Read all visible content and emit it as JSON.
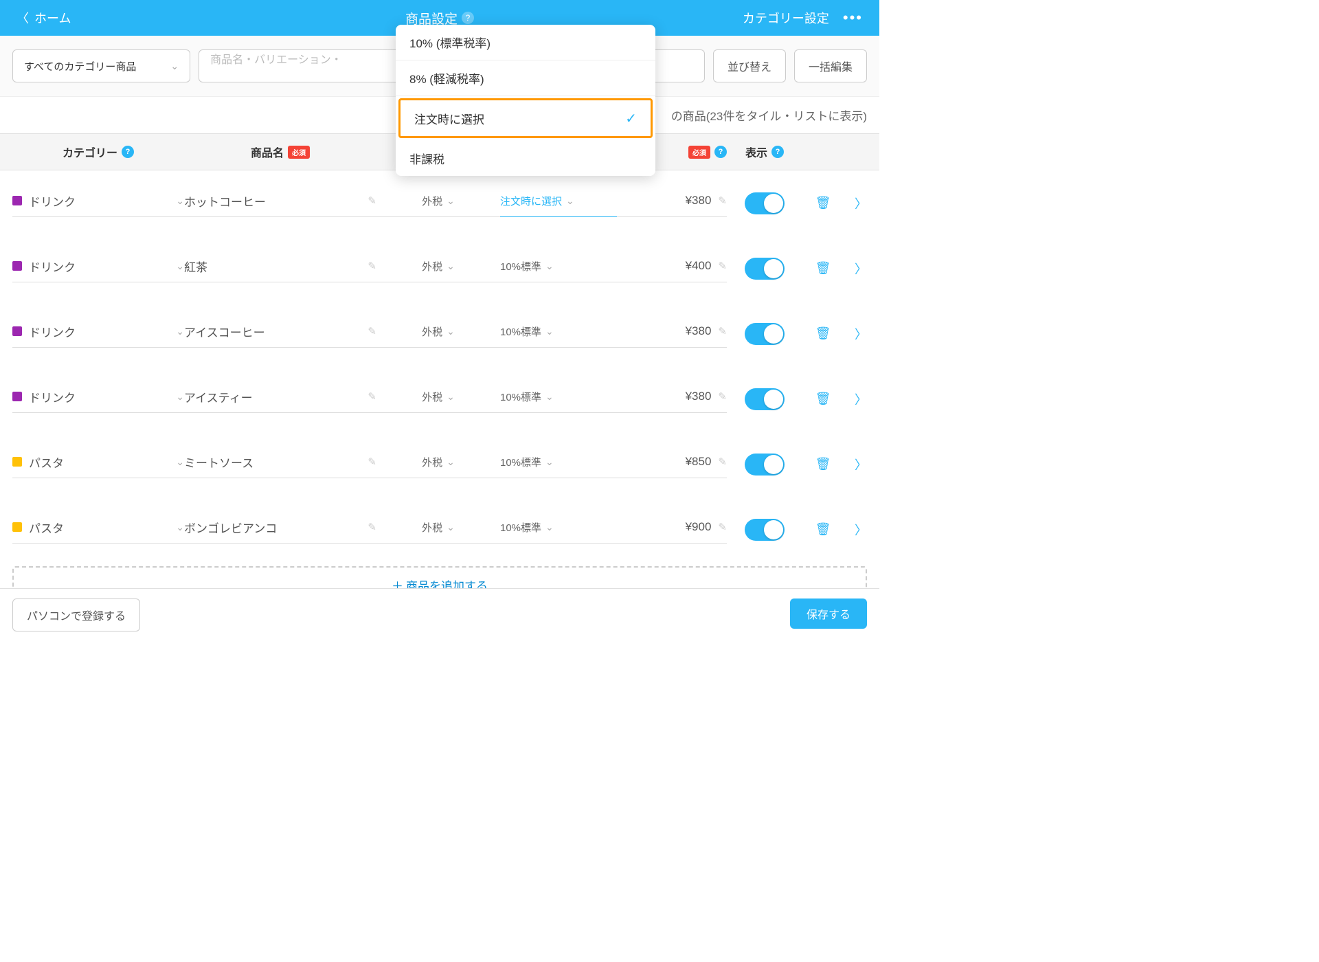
{
  "header": {
    "back": "ホーム",
    "title": "商品設定",
    "right_link": "カテゴリー設定"
  },
  "toolbar": {
    "category_filter": "すべてのカテゴリー商品",
    "search_placeholder": "商品名・バリエーション・",
    "sort_btn": "並び替え",
    "bulk_btn": "一括編集"
  },
  "summary": "の商品(23件をタイル・リストに表示)",
  "headers": {
    "category": "カテゴリー",
    "name": "商品名",
    "required": "必須",
    "display": "表示"
  },
  "dropdown": {
    "opt1": "10% (標準税率)",
    "opt2": "8% (軽減税率)",
    "opt3": "注文時に選択",
    "opt4": "非課税"
  },
  "rows": [
    {
      "cat": "ドリンク",
      "color": "purple",
      "name": "ホットコーヒー",
      "tax": "外税",
      "rate": "注文時に選択",
      "price": "¥380",
      "active": true
    },
    {
      "cat": "ドリンク",
      "color": "purple",
      "name": "紅茶",
      "tax": "外税",
      "rate": "10%標準",
      "price": "¥400",
      "active": false
    },
    {
      "cat": "ドリンク",
      "color": "purple",
      "name": "アイスコーヒー",
      "tax": "外税",
      "rate": "10%標準",
      "price": "¥380",
      "active": false
    },
    {
      "cat": "ドリンク",
      "color": "purple",
      "name": "アイスティー",
      "tax": "外税",
      "rate": "10%標準",
      "price": "¥380",
      "active": false
    },
    {
      "cat": "パスタ",
      "color": "yellow",
      "name": "ミートソース",
      "tax": "外税",
      "rate": "10%標準",
      "price": "¥850",
      "active": false
    },
    {
      "cat": "パスタ",
      "color": "yellow",
      "name": "ボンゴレビアンコ",
      "tax": "外税",
      "rate": "10%標準",
      "price": "¥900",
      "active": false
    }
  ],
  "add_button": "商品を追加する",
  "footer": {
    "pc_register": "パソコンで登録する",
    "save": "保存する"
  }
}
